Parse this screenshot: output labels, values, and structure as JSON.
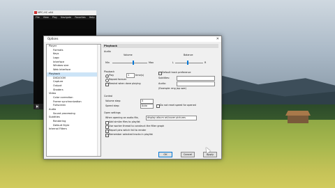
{
  "player": {
    "title": "MPC-HC x64",
    "menu": [
      "File",
      "View",
      "Play",
      "Navigate",
      "Favorites",
      "Help"
    ]
  },
  "dialog": {
    "title": "Options",
    "close": "✕",
    "tree": [
      {
        "label": "Player",
        "level": 0
      },
      {
        "label": "Formats",
        "level": 1
      },
      {
        "label": "Keys",
        "level": 1
      },
      {
        "label": "Logo",
        "level": 1
      },
      {
        "label": "Interface",
        "level": 1
      },
      {
        "label": "Window size",
        "level": 1
      },
      {
        "label": "Web Interface",
        "level": 1
      },
      {
        "label": "Playback",
        "level": 0,
        "selected": true
      },
      {
        "label": "DVD/OGM",
        "level": 1
      },
      {
        "label": "Capture",
        "level": 1
      },
      {
        "label": "Output",
        "level": 1
      },
      {
        "label": "Shaders",
        "level": 1
      },
      {
        "label": "Video",
        "level": 0
      },
      {
        "label": "Color correction",
        "level": 1
      },
      {
        "label": "Frame synchronization",
        "level": 1
      },
      {
        "label": "Fullscreen",
        "level": 1
      },
      {
        "label": "Audio",
        "level": 0
      },
      {
        "label": "Sound processing",
        "level": 1
      },
      {
        "label": "Subtitles",
        "level": 0
      },
      {
        "label": "Rendering",
        "level": 1
      },
      {
        "label": "Default Style",
        "level": 1
      },
      {
        "label": "Internal Filters",
        "level": 0
      }
    ],
    "panel": {
      "heading": "Playback",
      "audio_group": "Audio",
      "volume_label": "Volume",
      "volume_min": "Min",
      "volume_max": "Max",
      "volume_level": 0.6,
      "balance_label": "Balance",
      "balance_l": "L",
      "balance_r": "R",
      "balance_level": 0.45,
      "playback_group": "Playback",
      "play_label": "Play",
      "play_times": "1",
      "times_label": "time(s)",
      "repeat_forever": "Repeat forever",
      "rewind_label": "Rewind when done playing",
      "default_track": "Default track preference",
      "subtitles_label": "Subtitles:",
      "audio_label": "Audio:",
      "example_text": "(Example: eng jap swe)",
      "control_group": "Control",
      "volume_step_label": "Volume step:",
      "volume_step_value": "5",
      "speed_step_label": "Speed step:",
      "speed_step_value": "Auto",
      "no_reset_speed": "Do not reset speed for opened",
      "open_settings_group": "Open settings",
      "when_opening_label": "When opening an audio file,",
      "when_opening_value": "display album art/cover pictures",
      "add_similar": "Add similar files to playlist",
      "use_worker": "Use worker thread to construct the filter graph",
      "report_pins": "Report pins which fail to render",
      "remember_dvd": "Remember selected tracks in playlist"
    },
    "buttons": {
      "ok": "OK",
      "cancel": "Cancel",
      "apply": "Apply"
    }
  }
}
